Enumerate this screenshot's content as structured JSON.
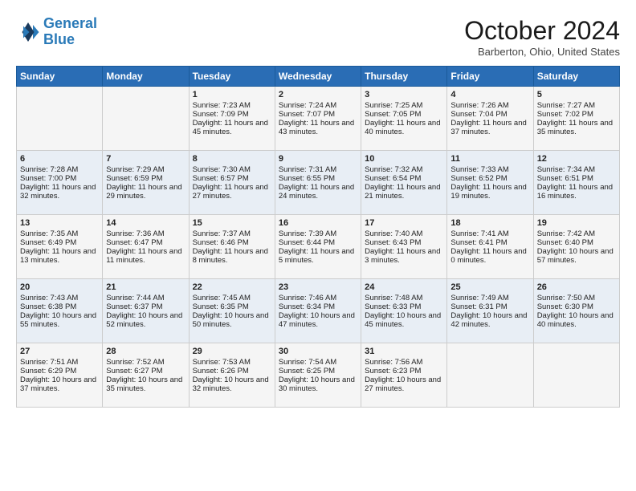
{
  "header": {
    "logo_line1": "General",
    "logo_line2": "Blue",
    "title": "October 2024",
    "location": "Barberton, Ohio, United States"
  },
  "days_of_week": [
    "Sunday",
    "Monday",
    "Tuesday",
    "Wednesday",
    "Thursday",
    "Friday",
    "Saturday"
  ],
  "weeks": [
    [
      {
        "day": "",
        "content": ""
      },
      {
        "day": "",
        "content": ""
      },
      {
        "day": "1",
        "content": "Sunrise: 7:23 AM\nSunset: 7:09 PM\nDaylight: 11 hours and 45 minutes."
      },
      {
        "day": "2",
        "content": "Sunrise: 7:24 AM\nSunset: 7:07 PM\nDaylight: 11 hours and 43 minutes."
      },
      {
        "day": "3",
        "content": "Sunrise: 7:25 AM\nSunset: 7:05 PM\nDaylight: 11 hours and 40 minutes."
      },
      {
        "day": "4",
        "content": "Sunrise: 7:26 AM\nSunset: 7:04 PM\nDaylight: 11 hours and 37 minutes."
      },
      {
        "day": "5",
        "content": "Sunrise: 7:27 AM\nSunset: 7:02 PM\nDaylight: 11 hours and 35 minutes."
      }
    ],
    [
      {
        "day": "6",
        "content": "Sunrise: 7:28 AM\nSunset: 7:00 PM\nDaylight: 11 hours and 32 minutes."
      },
      {
        "day": "7",
        "content": "Sunrise: 7:29 AM\nSunset: 6:59 PM\nDaylight: 11 hours and 29 minutes."
      },
      {
        "day": "8",
        "content": "Sunrise: 7:30 AM\nSunset: 6:57 PM\nDaylight: 11 hours and 27 minutes."
      },
      {
        "day": "9",
        "content": "Sunrise: 7:31 AM\nSunset: 6:55 PM\nDaylight: 11 hours and 24 minutes."
      },
      {
        "day": "10",
        "content": "Sunrise: 7:32 AM\nSunset: 6:54 PM\nDaylight: 11 hours and 21 minutes."
      },
      {
        "day": "11",
        "content": "Sunrise: 7:33 AM\nSunset: 6:52 PM\nDaylight: 11 hours and 19 minutes."
      },
      {
        "day": "12",
        "content": "Sunrise: 7:34 AM\nSunset: 6:51 PM\nDaylight: 11 hours and 16 minutes."
      }
    ],
    [
      {
        "day": "13",
        "content": "Sunrise: 7:35 AM\nSunset: 6:49 PM\nDaylight: 11 hours and 13 minutes."
      },
      {
        "day": "14",
        "content": "Sunrise: 7:36 AM\nSunset: 6:47 PM\nDaylight: 11 hours and 11 minutes."
      },
      {
        "day": "15",
        "content": "Sunrise: 7:37 AM\nSunset: 6:46 PM\nDaylight: 11 hours and 8 minutes."
      },
      {
        "day": "16",
        "content": "Sunrise: 7:39 AM\nSunset: 6:44 PM\nDaylight: 11 hours and 5 minutes."
      },
      {
        "day": "17",
        "content": "Sunrise: 7:40 AM\nSunset: 6:43 PM\nDaylight: 11 hours and 3 minutes."
      },
      {
        "day": "18",
        "content": "Sunrise: 7:41 AM\nSunset: 6:41 PM\nDaylight: 11 hours and 0 minutes."
      },
      {
        "day": "19",
        "content": "Sunrise: 7:42 AM\nSunset: 6:40 PM\nDaylight: 10 hours and 57 minutes."
      }
    ],
    [
      {
        "day": "20",
        "content": "Sunrise: 7:43 AM\nSunset: 6:38 PM\nDaylight: 10 hours and 55 minutes."
      },
      {
        "day": "21",
        "content": "Sunrise: 7:44 AM\nSunset: 6:37 PM\nDaylight: 10 hours and 52 minutes."
      },
      {
        "day": "22",
        "content": "Sunrise: 7:45 AM\nSunset: 6:35 PM\nDaylight: 10 hours and 50 minutes."
      },
      {
        "day": "23",
        "content": "Sunrise: 7:46 AM\nSunset: 6:34 PM\nDaylight: 10 hours and 47 minutes."
      },
      {
        "day": "24",
        "content": "Sunrise: 7:48 AM\nSunset: 6:33 PM\nDaylight: 10 hours and 45 minutes."
      },
      {
        "day": "25",
        "content": "Sunrise: 7:49 AM\nSunset: 6:31 PM\nDaylight: 10 hours and 42 minutes."
      },
      {
        "day": "26",
        "content": "Sunrise: 7:50 AM\nSunset: 6:30 PM\nDaylight: 10 hours and 40 minutes."
      }
    ],
    [
      {
        "day": "27",
        "content": "Sunrise: 7:51 AM\nSunset: 6:29 PM\nDaylight: 10 hours and 37 minutes."
      },
      {
        "day": "28",
        "content": "Sunrise: 7:52 AM\nSunset: 6:27 PM\nDaylight: 10 hours and 35 minutes."
      },
      {
        "day": "29",
        "content": "Sunrise: 7:53 AM\nSunset: 6:26 PM\nDaylight: 10 hours and 32 minutes."
      },
      {
        "day": "30",
        "content": "Sunrise: 7:54 AM\nSunset: 6:25 PM\nDaylight: 10 hours and 30 minutes."
      },
      {
        "day": "31",
        "content": "Sunrise: 7:56 AM\nSunset: 6:23 PM\nDaylight: 10 hours and 27 minutes."
      },
      {
        "day": "",
        "content": ""
      },
      {
        "day": "",
        "content": ""
      }
    ]
  ]
}
